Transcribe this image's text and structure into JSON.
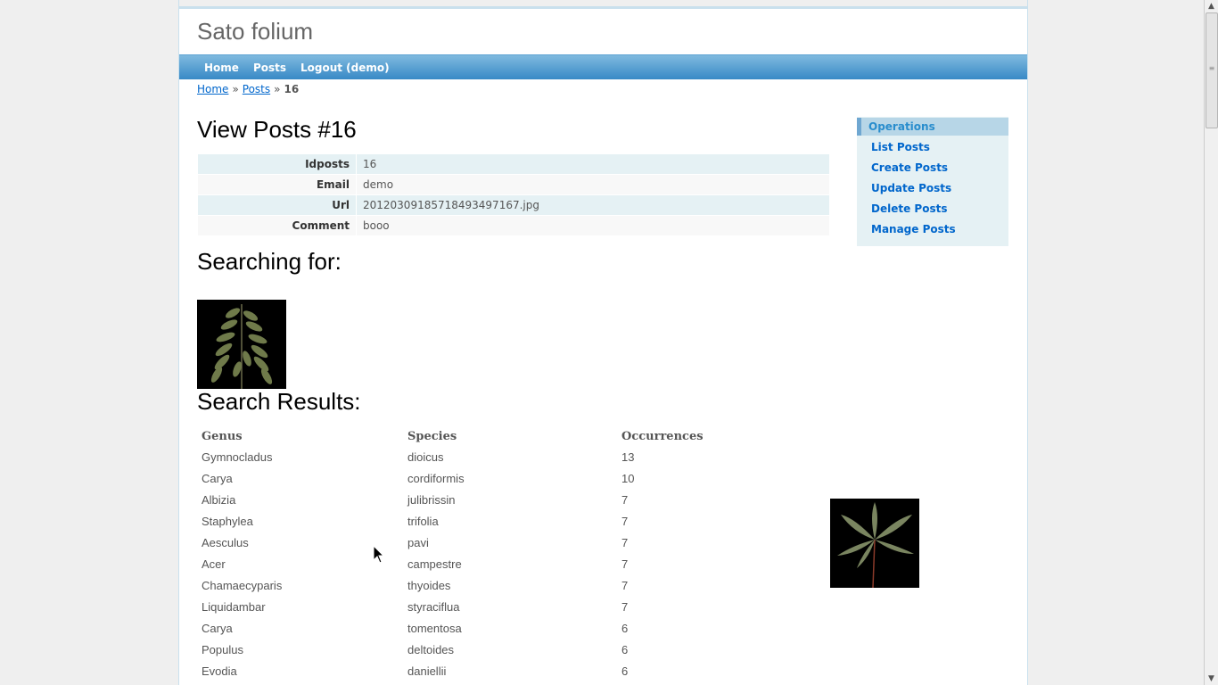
{
  "site": {
    "title": "Sato folium"
  },
  "menu": {
    "items": [
      "Home",
      "Posts",
      "Logout (demo)"
    ]
  },
  "breadcrumbs": {
    "home": "Home",
    "sep": "»",
    "posts": "Posts",
    "current": "16"
  },
  "view": {
    "title": "View Posts #16",
    "rows": [
      {
        "label": "Idposts",
        "value": "16"
      },
      {
        "label": "Email",
        "value": "demo"
      },
      {
        "label": "Url",
        "value": "20120309185718493497167.jpg"
      },
      {
        "label": "Comment",
        "value": "booo"
      }
    ]
  },
  "search": {
    "title": "Searching for:"
  },
  "results": {
    "title": "Search Results:",
    "headers": {
      "genus": "Genus",
      "species": "Species",
      "occurrences": "Occurrences"
    },
    "rows": [
      {
        "genus": "Gymnocladus",
        "species": "dioicus",
        "occurrences": "13"
      },
      {
        "genus": "Carya",
        "species": "cordiformis",
        "occurrences": "10"
      },
      {
        "genus": "Albizia",
        "species": "julibrissin",
        "occurrences": "7"
      },
      {
        "genus": "Staphylea",
        "species": "trifolia",
        "occurrences": "7"
      },
      {
        "genus": "Aesculus",
        "species": "pavi",
        "occurrences": "7"
      },
      {
        "genus": "Acer",
        "species": "campestre",
        "occurrences": "7"
      },
      {
        "genus": "Chamaecyparis",
        "species": "thyoides",
        "occurrences": "7"
      },
      {
        "genus": "Liquidambar",
        "species": "styraciflua",
        "occurrences": "7"
      },
      {
        "genus": "Carya",
        "species": "tomentosa",
        "occurrences": "6"
      },
      {
        "genus": "Populus",
        "species": "deltoides",
        "occurrences": "6"
      },
      {
        "genus": "Evodia",
        "species": "daniellii",
        "occurrences": "6"
      }
    ]
  },
  "operations": {
    "title": "Operations",
    "items": [
      "List Posts",
      "Create Posts",
      "Update Posts",
      "Delete Posts",
      "Manage Posts"
    ]
  },
  "icons": {
    "scroll_up": "scroll-up-arrow-icon",
    "scroll_down": "scroll-down-arrow-icon",
    "cursor": "mouse-pointer-icon"
  }
}
